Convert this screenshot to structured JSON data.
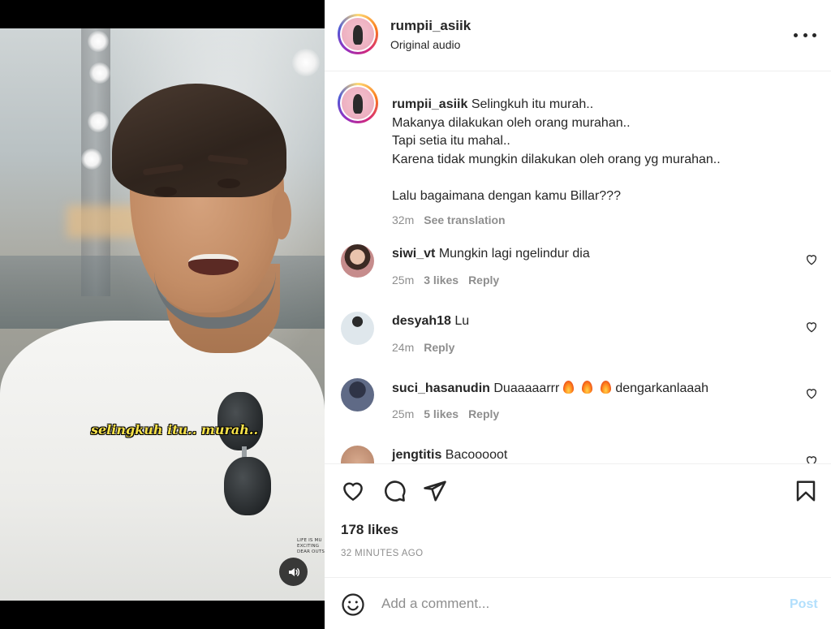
{
  "video": {
    "caption_text": "selingkuh itu.. murah..",
    "shirt_print": "LIFE IS MU\nEXCITING\nDEAR OUTS",
    "sound_icon": "speaker-icon"
  },
  "post": {
    "username": "rumpii_asiik",
    "audio_label": "Original audio",
    "more_icon": "more-horizontal-icon"
  },
  "caption": {
    "username": "rumpii_asiik",
    "text": "Selingkuh itu murah..\nMakanya dilakukan oleh orang murahan..\nTapi setia itu mahal..\nKarena tidak mungkin dilakukan oleh orang yg murahan..\n\nLalu bagaimana dengan kamu Billar???",
    "time": "32m",
    "translate_label": "See translation"
  },
  "comments": [
    {
      "username": "siwi_vt",
      "text": "Mungkin lagi ngelindur dia",
      "time": "25m",
      "likes": "3 likes",
      "reply": "Reply",
      "avatar_color": "#c68c8c"
    },
    {
      "username": "desyah18",
      "text": "Lu",
      "time": "24m",
      "likes": "",
      "reply": "Reply",
      "avatar_color": "#a7b7c2"
    },
    {
      "username": "suci_hasanudin",
      "text_parts": [
        "Duaaaaarrr",
        "dengarkanlaaah"
      ],
      "time": "25m",
      "likes": "5 likes",
      "reply": "Reply",
      "avatar_color": "#5f6a86"
    },
    {
      "username": "jengtitis",
      "text": "Bacooooot",
      "avatar_color": "#d7a98d"
    }
  ],
  "actions": {
    "icons": [
      "heart-icon",
      "comment-icon",
      "share-icon",
      "bookmark-icon"
    ],
    "likes": "178 likes",
    "time_ago": "32 MINUTES AGO"
  },
  "composer": {
    "placeholder": "Add a comment...",
    "post_label": "Post"
  },
  "colors": {
    "text": "#262626",
    "muted": "#8e8e8e",
    "post_disabled": "#b2dffc",
    "caption_yellow": "#f7e24a"
  }
}
